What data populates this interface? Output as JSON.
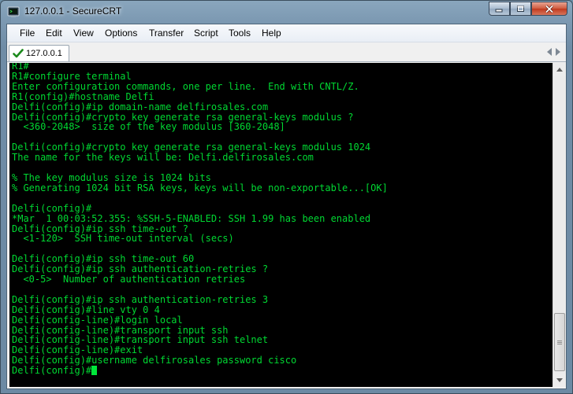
{
  "window": {
    "title": "127.0.0.1 - SecureCRT",
    "icon": "securecrt-icon",
    "controls": [
      "minimize-icon",
      "maximize-icon",
      "close-icon"
    ]
  },
  "menu": {
    "items": [
      "File",
      "Edit",
      "View",
      "Options",
      "Transfer",
      "Script",
      "Tools",
      "Help"
    ]
  },
  "tabs": [
    {
      "label": "127.0.0.1",
      "status_icon": "connected-check-icon",
      "active": true
    }
  ],
  "terminal": {
    "colors": {
      "background": "#000000",
      "foreground": "#00d832"
    },
    "lines": [
      "R1#",
      "R1#configure terminal",
      "Enter configuration commands, one per line.  End with CNTL/Z.",
      "R1(config)#hostname Delfi",
      "Delfi(config)#ip domain-name delfirosales.com",
      "Delfi(config)#crypto key generate rsa general-keys modulus ?",
      "  <360-2048>  size of the key modulus [360-2048]",
      "",
      "Delfi(config)#crypto key generate rsa general-keys modulus 1024",
      "The name for the keys will be: Delfi.delfirosales.com",
      "",
      "% The key modulus size is 1024 bits",
      "% Generating 1024 bit RSA keys, keys will be non-exportable...[OK]",
      "",
      "Delfi(config)#",
      "*Mar  1 00:03:52.355: %SSH-5-ENABLED: SSH 1.99 has been enabled",
      "Delfi(config)#ip ssh time-out ?",
      "  <1-120>  SSH time-out interval (secs)",
      "",
      "Delfi(config)#ip ssh time-out 60",
      "Delfi(config)#ip ssh authentication-retries ?",
      "  <0-5>  Number of authentication retries",
      "",
      "Delfi(config)#ip ssh authentication-retries 3",
      "Delfi(config)#line vty 0 4",
      "Delfi(config-line)#login local",
      "Delfi(config-line)#transport input ssh",
      "Delfi(config-line)#transport input ssh telnet",
      "Delfi(config-line)#exit",
      "Delfi(config)#username delfirosales password cisco"
    ],
    "prompt": "Delfi(config)#"
  }
}
